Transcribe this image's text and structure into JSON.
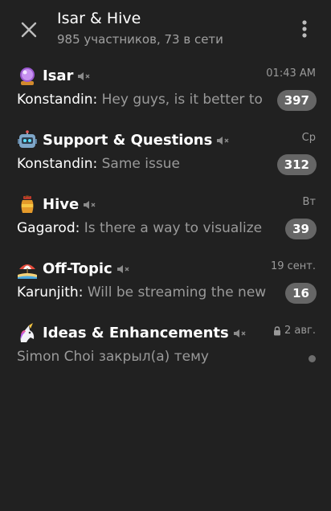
{
  "header": {
    "title": "Isar & Hive",
    "subtitle": "985 участников, 73 в сети"
  },
  "topics": [
    {
      "name": "Isar",
      "emoji": "crystal-ball-icon",
      "time": "01:43 AM",
      "author": "Konstandin:",
      "text": " Hey guys, is it better to",
      "badge": "397",
      "muted": true,
      "locked": false
    },
    {
      "name": "Support & Questions",
      "emoji": "robot-icon",
      "time": "Ср",
      "author": "Konstandin:",
      "text": " Same issue",
      "badge": "312",
      "muted": true,
      "locked": false
    },
    {
      "name": "Hive",
      "emoji": "honey-pot-icon",
      "time": "Вт",
      "author": "Gagarod:",
      "text": " Is there a way to visualize",
      "badge": "39",
      "muted": true,
      "locked": false
    },
    {
      "name": "Off-Topic",
      "emoji": "beach-icon",
      "time": "19 сент.",
      "author": "Karunjith:",
      "text": " Will be streaming the new",
      "badge": "16",
      "muted": true,
      "locked": false
    },
    {
      "name": "Ideas & Enhancements",
      "emoji": "unicorn-icon",
      "time": "2 авг.",
      "author": "",
      "text": "Simon Choi закрыл(а) тему",
      "badge": "",
      "muted": true,
      "locked": true
    }
  ],
  "colors": {
    "background": "#212121",
    "badge": "#666666",
    "secondary_text": "#9a9a9a"
  }
}
